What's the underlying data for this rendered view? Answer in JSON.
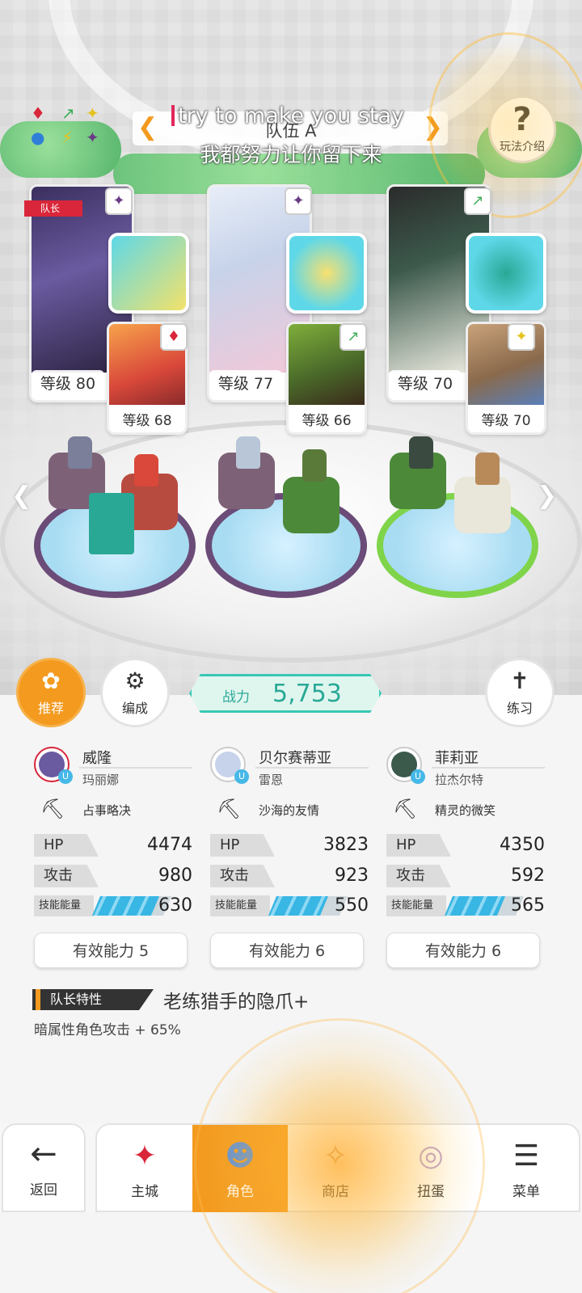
{
  "lyrics": {
    "line1": "try to make you stay",
    "line2": "我都努力让你留下来"
  },
  "team": {
    "title": "队伍 A",
    "prev_arrow": "❮",
    "next_arrow": "❯"
  },
  "help": {
    "icon": "?",
    "label": "玩法介绍"
  },
  "element_icons": [
    "♦",
    "♥",
    "↗",
    "✦",
    "●",
    "⚡",
    "✦"
  ],
  "leader_tag": "队长",
  "heroes": [
    {
      "main_level": "等级 80",
      "sub_level": "等级 68",
      "main_badge": "✦",
      "sub_badge": "♦"
    },
    {
      "main_level": "等级 77",
      "sub_level": "等级 66",
      "main_badge": "✦",
      "sub_badge": "↗"
    },
    {
      "main_level": "等级 70",
      "sub_level": "等级 70",
      "main_badge": "↗",
      "sub_badge": "✦"
    }
  ],
  "side_arrows": {
    "left": "❮",
    "right": "❯"
  },
  "actions": {
    "recommend": "推荐",
    "formation": "编成",
    "practice": "练习"
  },
  "power": {
    "label": "战力",
    "value": "5,753"
  },
  "columns": [
    {
      "name": "威隆",
      "sub": "玛丽娜",
      "skill": "占事略决",
      "hp_label": "HP",
      "hp": "4474",
      "atk_label": "攻击",
      "atk": "980",
      "energy_label": "技能能量",
      "energy": "630",
      "energy_fill": 0.85,
      "effective": "有效能力 5"
    },
    {
      "name": "贝尔赛蒂亚",
      "sub": "雷恩",
      "skill": "沙海的友情",
      "hp_label": "HP",
      "hp": "3823",
      "atk_label": "攻击",
      "atk": "923",
      "energy_label": "技能能量",
      "energy": "550",
      "energy_fill": 0.75,
      "effective": "有效能力 6"
    },
    {
      "name": "菲莉亚",
      "sub": "拉杰尔特",
      "skill": "精灵的微笑",
      "hp_label": "HP",
      "hp": "4350",
      "atk_label": "攻击",
      "atk": "592",
      "energy_label": "技能能量",
      "energy": "565",
      "energy_fill": 0.77,
      "effective": "有效能力 6"
    }
  ],
  "leader_trait": {
    "tag": "队长特性",
    "title": "老练猎手的隐爪+",
    "desc": "暗属性角色攻击 + 65%"
  },
  "nav": {
    "back": "返回",
    "items": [
      "主城",
      "角色",
      "商店",
      "扭蛋",
      "菜单"
    ]
  },
  "colors": {
    "accent": "#f39a1f",
    "power": "#38c7b5",
    "leader": "#d9263a",
    "energy": "#38b6e4"
  }
}
